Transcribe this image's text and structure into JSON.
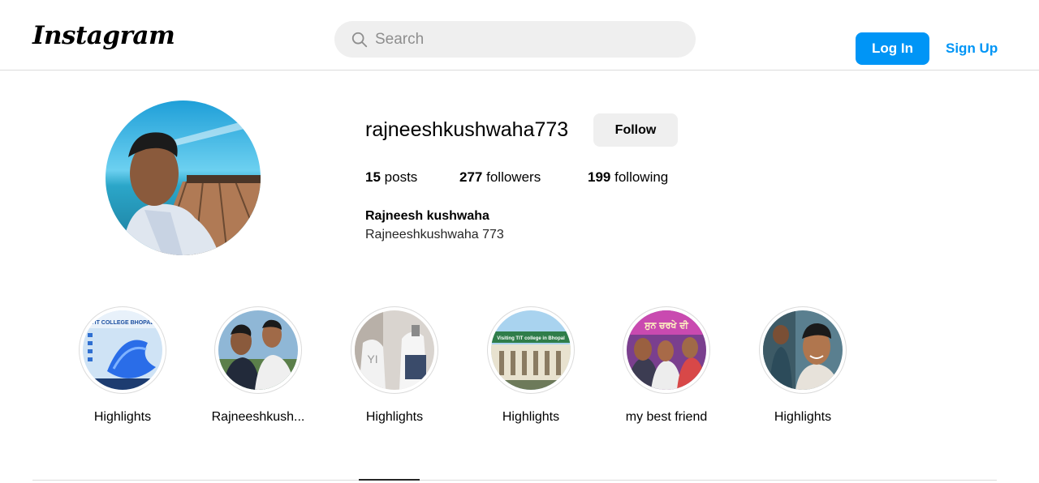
{
  "header": {
    "logo_text": "Instagram",
    "search_placeholder": "Search",
    "login_label": "Log In",
    "signup_label": "Sign Up"
  },
  "profile": {
    "username": "rajneeshkushwaha773",
    "follow_label": "Follow",
    "posts_count": "15",
    "posts_label": "posts",
    "followers_count": "277",
    "followers_label": "followers",
    "following_count": "199",
    "following_label": "following",
    "full_name": "Rajneesh kushwaha",
    "bio": "Rajneeshkushwaha 773"
  },
  "highlights": [
    {
      "label": "Highlights",
      "image_text": "TIT COLLEGE BHOPAL"
    },
    {
      "label": "Rajneeshkush..."
    },
    {
      "label": "Highlights"
    },
    {
      "label": "Highlights",
      "image_text": "Visiting TIT college in Bhopal"
    },
    {
      "label": "my best friend",
      "image_text": "ਸੁਨ ਚਰਖੇ ਦੀ"
    },
    {
      "label": "Highlights"
    }
  ],
  "colors": {
    "accent": "#0095f6",
    "border": "#dbdbdb",
    "button_bg": "#efefef"
  }
}
